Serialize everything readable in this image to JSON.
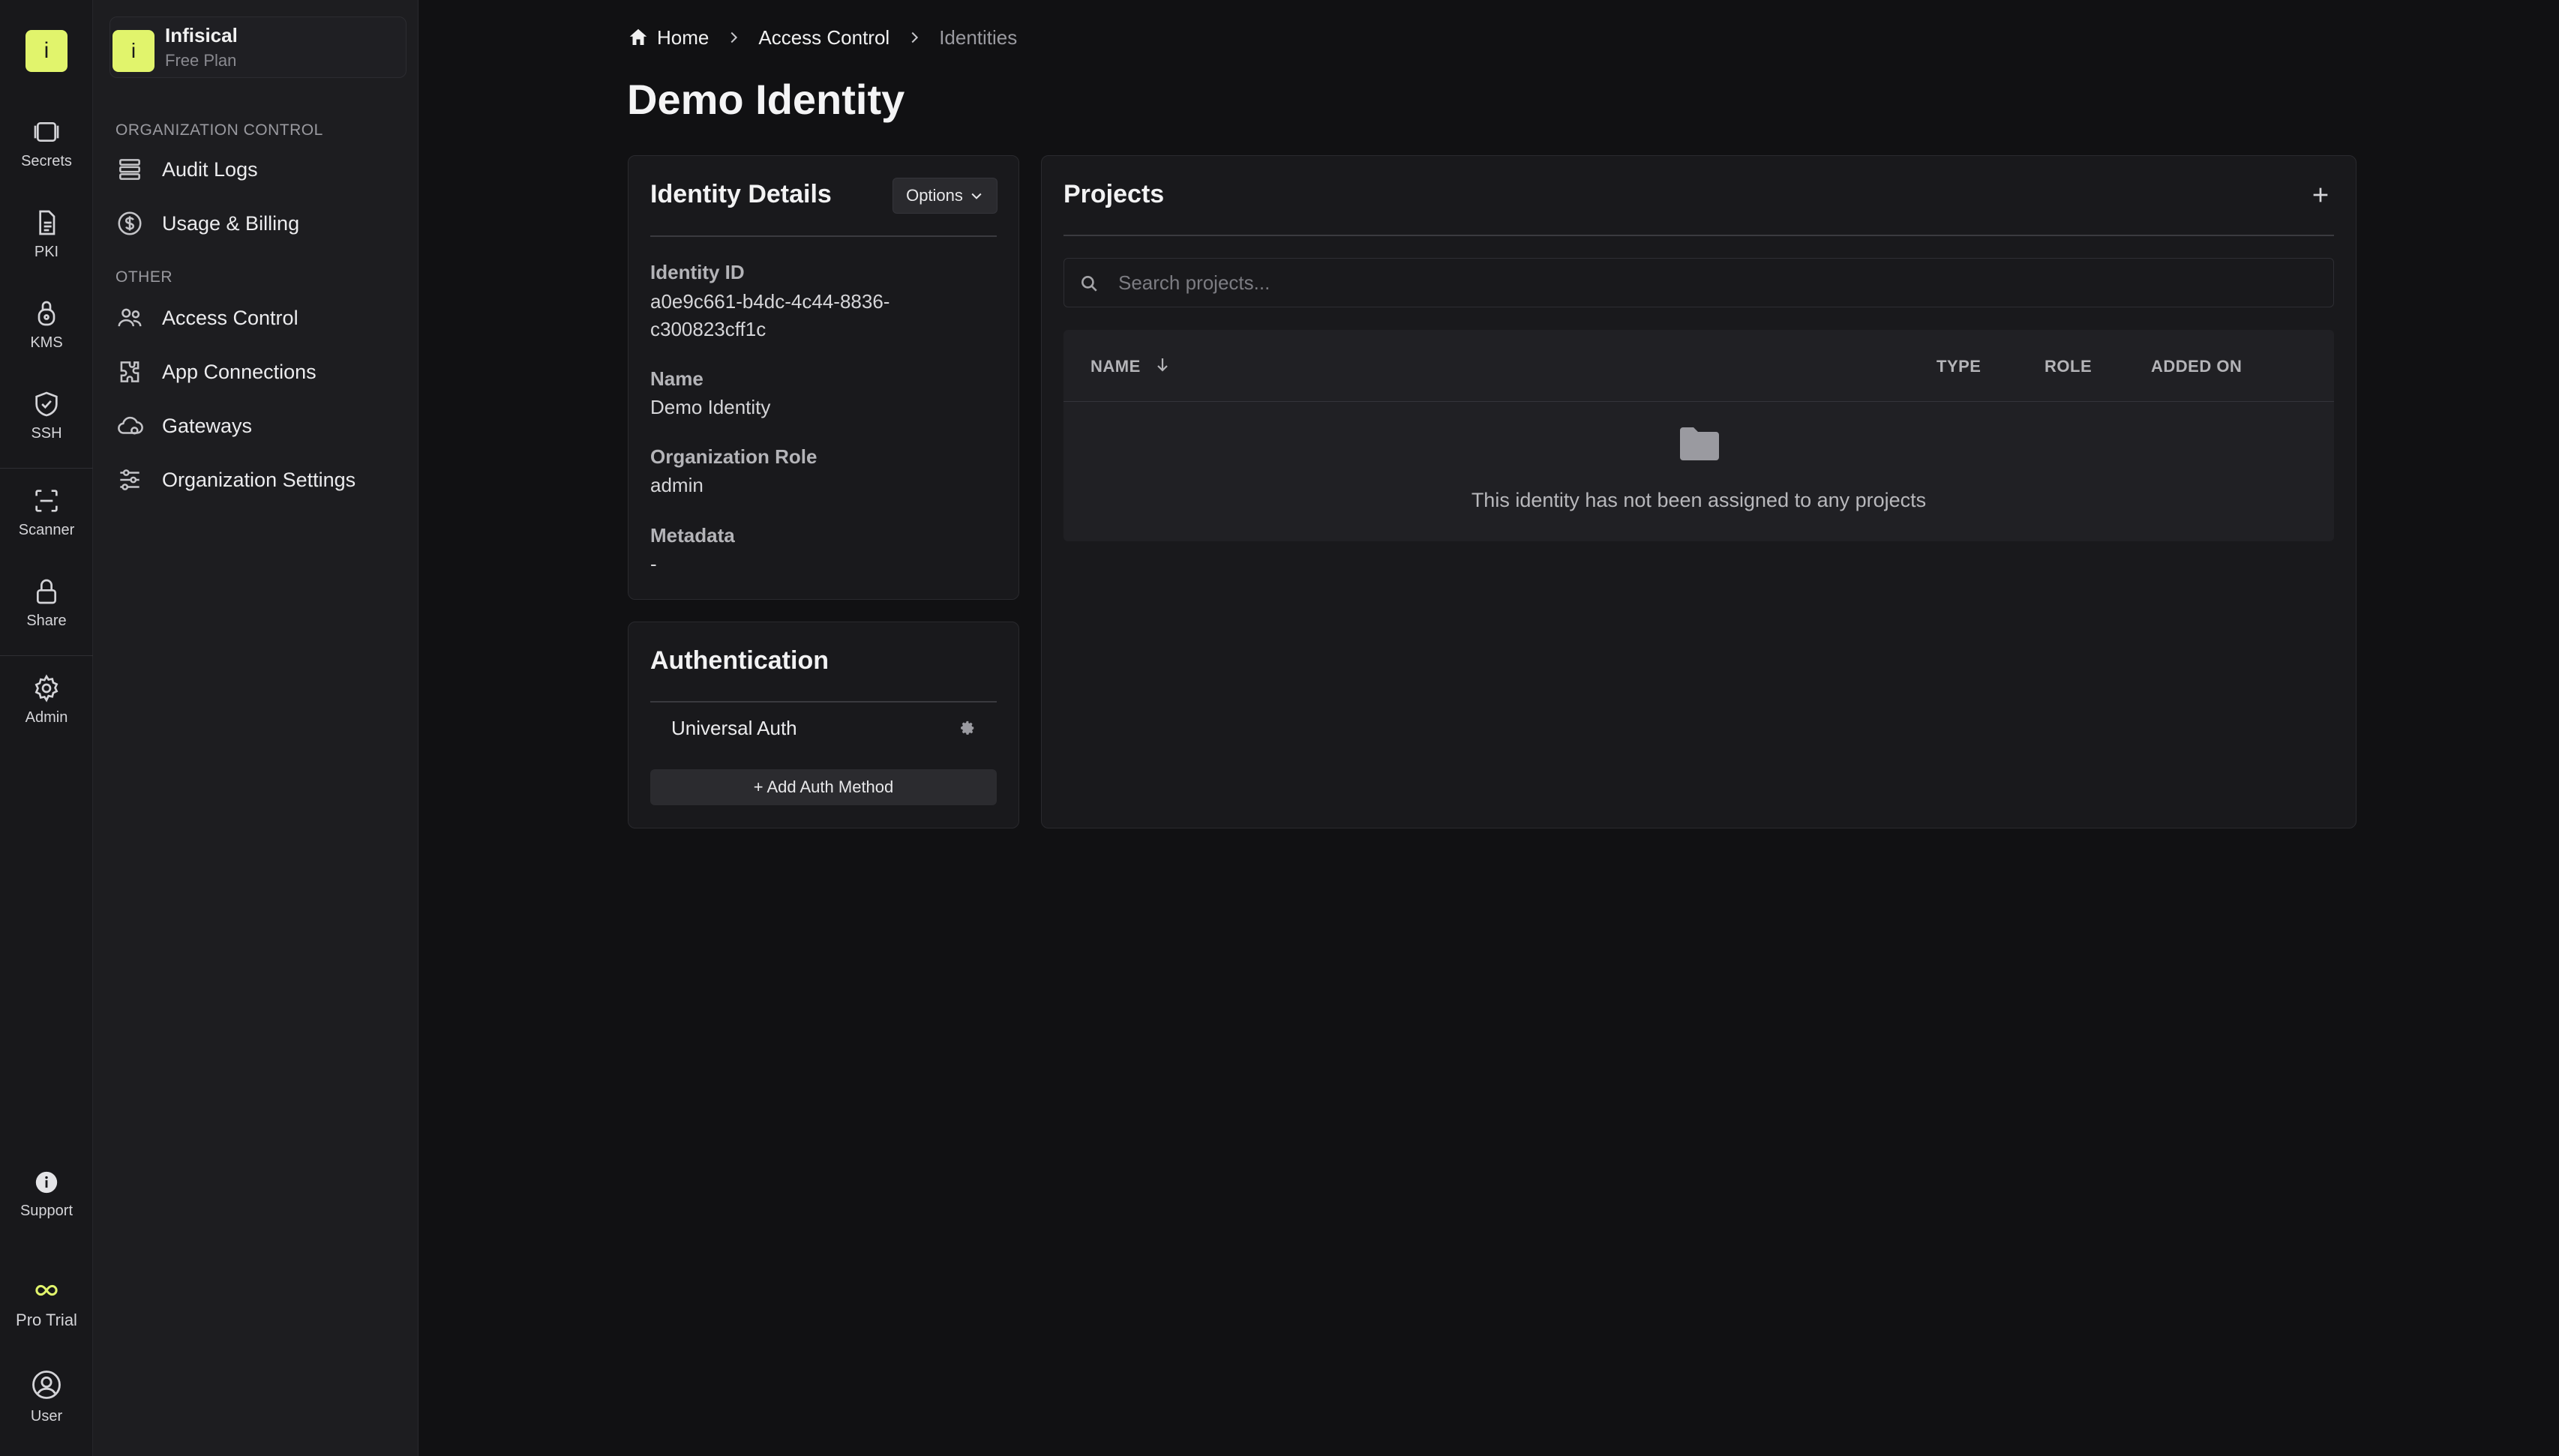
{
  "colors": {
    "accent": "#e1f46c",
    "background": "#111113",
    "sidebar": "#1d1d20"
  },
  "rail": {
    "logo": "i",
    "items": [
      {
        "label": "Secrets",
        "icon": "secrets-icon"
      },
      {
        "label": "PKI",
        "icon": "document-icon"
      },
      {
        "label": "KMS",
        "icon": "key-lock-icon"
      },
      {
        "label": "SSH",
        "icon": "shield-check-icon"
      },
      {
        "label": "Scanner",
        "icon": "scan-icon"
      },
      {
        "label": "Share",
        "icon": "lock-icon"
      },
      {
        "label": "Admin",
        "icon": "gear-icon"
      }
    ],
    "support": "Support",
    "trial": "Pro Trial",
    "user": "User"
  },
  "org": {
    "badge": "i",
    "name": "Infisical",
    "plan": "Free Plan"
  },
  "subnav": {
    "section1": "ORGANIZATION CONTROL",
    "section1_items": [
      {
        "label": "Audit Logs",
        "icon": "list-icon"
      },
      {
        "label": "Usage & Billing",
        "icon": "dollar-icon"
      }
    ],
    "section2": "OTHER",
    "section2_items": [
      {
        "label": "Access Control",
        "icon": "users-icon"
      },
      {
        "label": "App Connections",
        "icon": "puzzle-icon"
      },
      {
        "label": "Gateways",
        "icon": "cloud-icon"
      },
      {
        "label": "Organization Settings",
        "icon": "sliders-icon"
      }
    ]
  },
  "breadcrumb": {
    "home": "Home",
    "access_control": "Access Control",
    "current": "Identities"
  },
  "page": {
    "title": "Demo Identity"
  },
  "identity_details": {
    "title": "Identity Details",
    "options_label": "Options",
    "id_label": "Identity ID",
    "id_line1": "a0e9c661-b4dc-4c44-8836-",
    "id_line2": "c300823cff1c",
    "name_label": "Name",
    "name_value": "Demo Identity",
    "role_label": "Organization Role",
    "role_value": "admin",
    "metadata_label": "Metadata",
    "metadata_value": "-"
  },
  "authentication": {
    "title": "Authentication",
    "method": "Universal Auth",
    "add_label": "+ Add Auth Method"
  },
  "projects": {
    "title": "Projects",
    "search_placeholder": "Search projects...",
    "columns": {
      "name": "NAME",
      "type": "TYPE",
      "role": "ROLE",
      "added_on": "ADDED ON"
    },
    "empty_text": "This identity has not been assigned to any projects"
  }
}
